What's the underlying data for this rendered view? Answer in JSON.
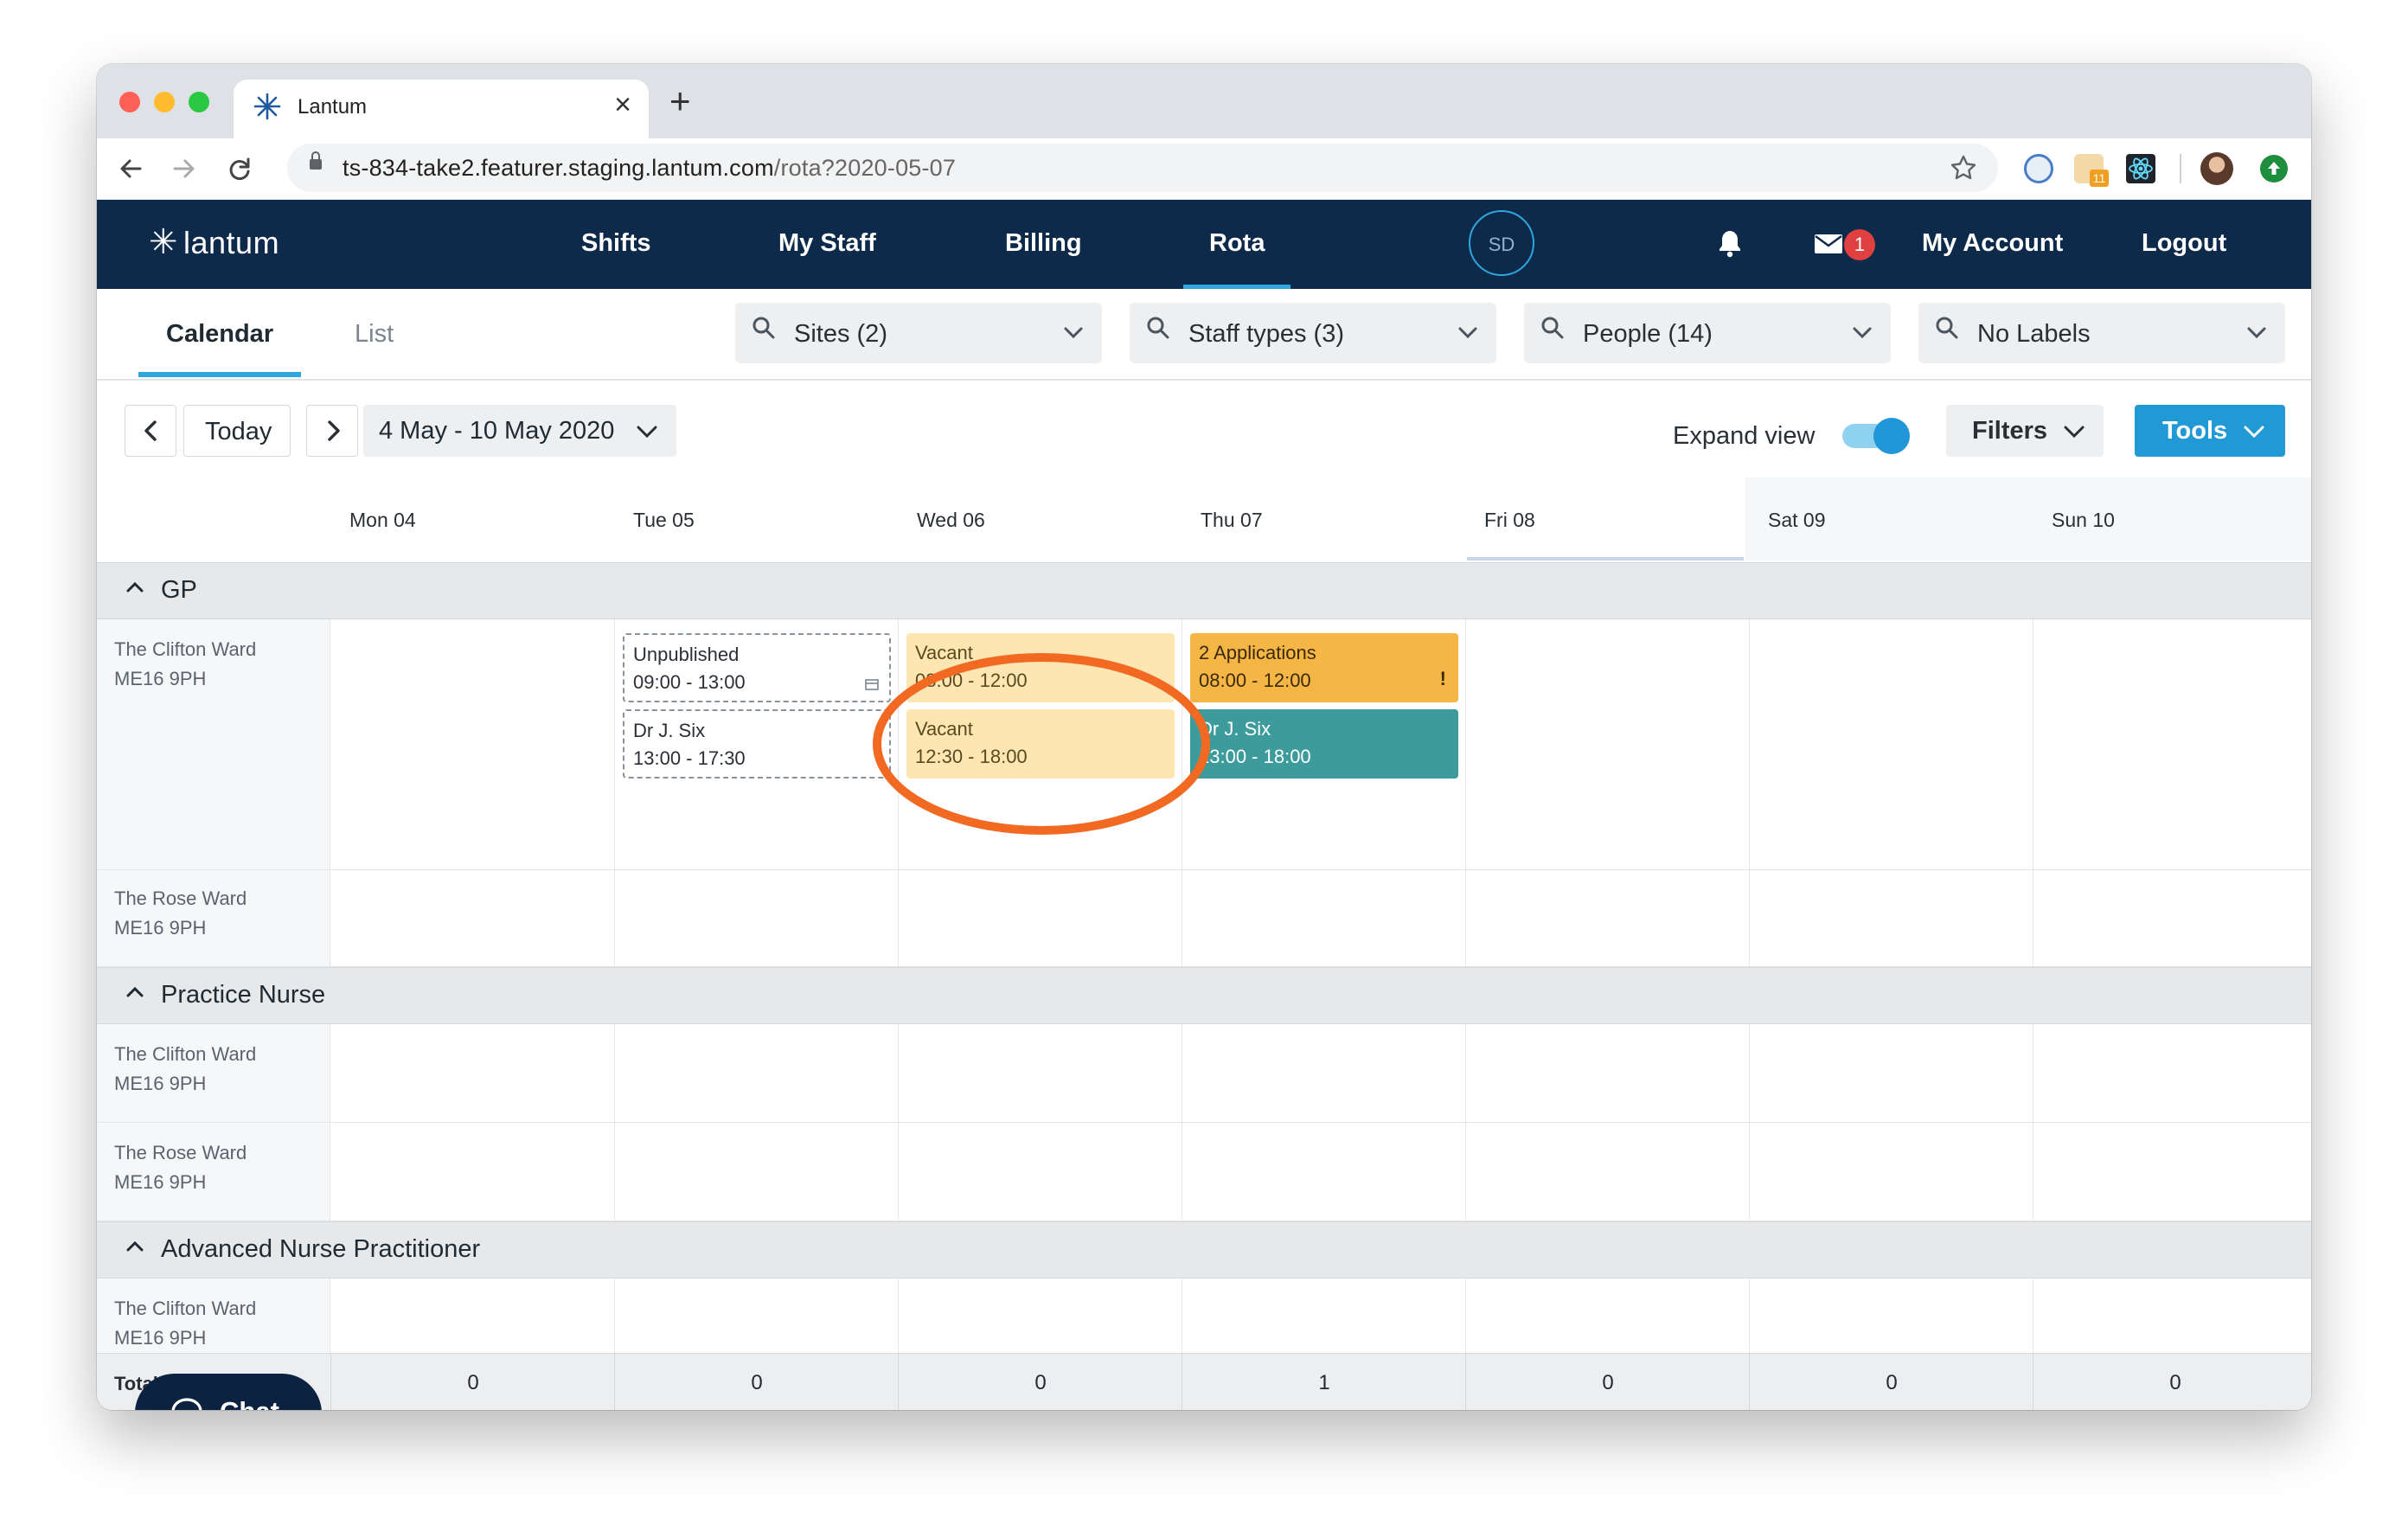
{
  "browser": {
    "tab_title": "Lantum",
    "new_tab": "+",
    "close": "×",
    "url_host": "ts-834-take2.featurer.staging.lantum.com",
    "url_path": "/rota?2020-05-07",
    "extension_badge": "11"
  },
  "app": {
    "logo": "lantum",
    "nav": [
      "Shifts",
      "My Staff",
      "Billing",
      "Rota"
    ],
    "active_nav": "Rota",
    "avatar_initials": "SD",
    "message_count": "1",
    "my_account": "My Account",
    "logout": "Logout"
  },
  "subnav": {
    "tabs": [
      "Calendar",
      "List"
    ],
    "active_tab": "Calendar",
    "filters": [
      "Sites (2)",
      "Staff types (3)",
      "People (14)",
      "No Labels"
    ]
  },
  "datebar": {
    "today": "Today",
    "range": "4 May - 10 May 2020",
    "expand_view": "Expand view",
    "expand_view_on": true,
    "filters": "Filters",
    "tools": "Tools"
  },
  "calendar": {
    "days": [
      "Mon 04",
      "Tue 05",
      "Wed 06",
      "Thu 07",
      "Fri 08",
      "Sat 09",
      "Sun 10"
    ],
    "selected_day": "Fri 08",
    "sections": [
      {
        "title": "GP",
        "rows": [
          {
            "ward": "The Clifton Ward",
            "postcode": "ME16 9PH"
          },
          {
            "ward": "The Rose Ward",
            "postcode": "ME16 9PH"
          }
        ]
      },
      {
        "title": "Practice Nurse",
        "rows": [
          {
            "ward": "The Clifton Ward",
            "postcode": "ME16 9PH"
          },
          {
            "ward": "The Rose Ward",
            "postcode": "ME16 9PH"
          }
        ]
      },
      {
        "title": "Advanced Nurse Practitioner",
        "rows": [
          {
            "ward": "The Clifton Ward",
            "postcode": "ME16 9PH"
          }
        ]
      }
    ],
    "shifts": [
      {
        "day": "Tue 05",
        "label": "Unpublished",
        "time": "09:00 - 13:00",
        "style": "unpublished"
      },
      {
        "day": "Tue 05",
        "label": "Dr J. Six",
        "time": "13:00 - 17:30",
        "style": "unpublished"
      },
      {
        "day": "Wed 06",
        "label": "Vacant",
        "time": "08:00 - 12:00",
        "style": "vacant"
      },
      {
        "day": "Wed 06",
        "label": "Vacant",
        "time": "12:30 - 18:00",
        "style": "vacant"
      },
      {
        "day": "Thu 07",
        "label": "2 Applications",
        "time": "08:00 - 12:00",
        "style": "applications",
        "flag": "!"
      },
      {
        "day": "Thu 07",
        "label": "Dr J. Six",
        "time": "13:00 - 18:00",
        "style": "filled"
      }
    ],
    "total_label": "Total Staff",
    "totals": [
      "0",
      "0",
      "0",
      "1",
      "0",
      "0",
      "0"
    ]
  },
  "chat": {
    "label": "Chat"
  },
  "colors": {
    "nav_bg": "#0e2a4a",
    "accent": "#2ea7e0",
    "vacant": "#fde6b2",
    "applications": "#f6b645",
    "filled": "#3d9b9b",
    "annotation": "#f26a22",
    "badge": "#e0403f"
  }
}
